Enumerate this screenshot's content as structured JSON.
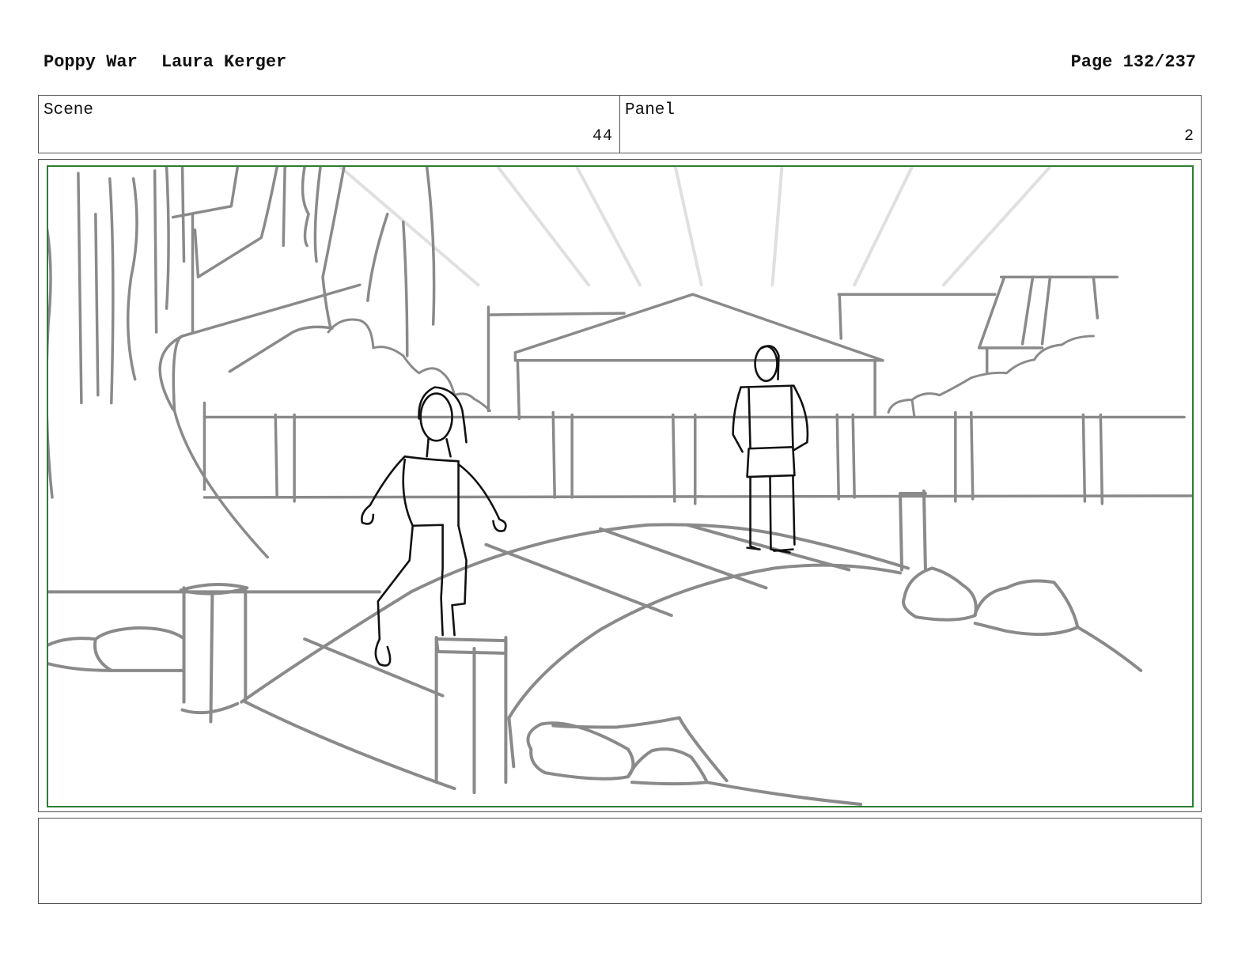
{
  "header": {
    "project": "Poppy War",
    "author": "Laura Kerger",
    "page": "Page 132/237"
  },
  "scene": {
    "label": "Scene",
    "value": "44"
  },
  "panel": {
    "label": "Panel",
    "value": "2"
  },
  "frame": {
    "border_color": "#2e7d32",
    "sketch_color": "#8a8a8a",
    "figure_color": "#111111"
  },
  "notes": {
    "text": ""
  }
}
